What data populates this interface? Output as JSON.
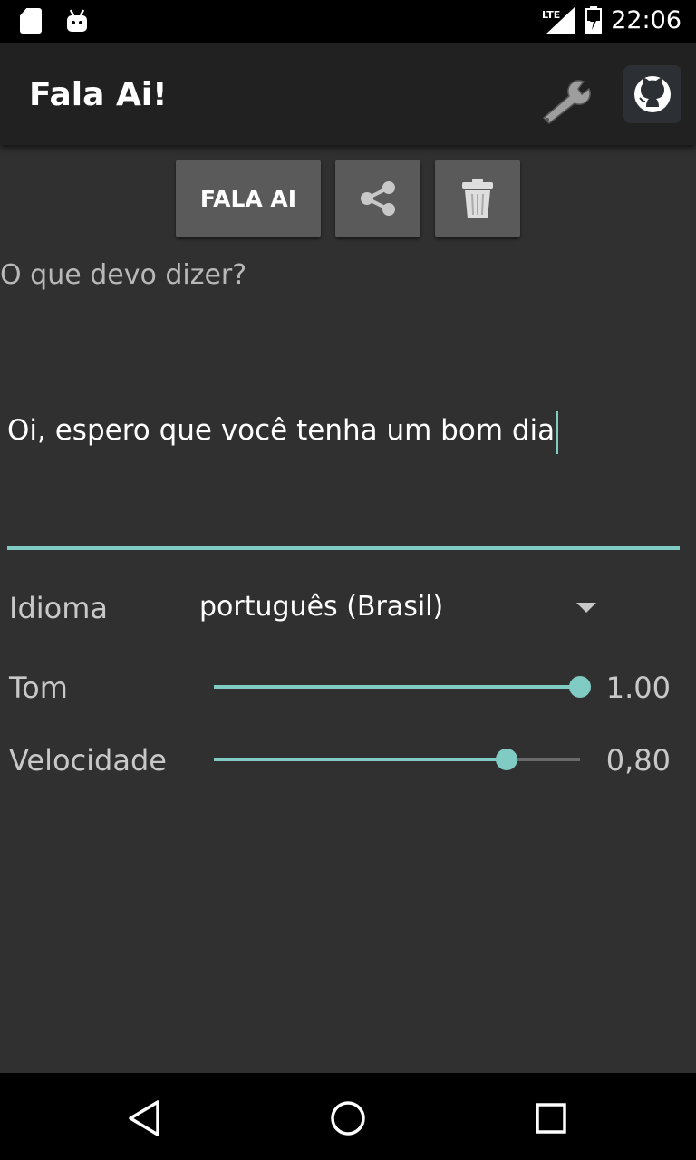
{
  "status_bar": {
    "time": "22:06",
    "network": "LTE",
    "icons": [
      "sd-card-icon",
      "android-icon",
      "lte-signal-icon",
      "battery-icon"
    ]
  },
  "app_bar": {
    "title": "Fala Ai!",
    "actions": [
      "wrench-icon",
      "github-icon"
    ]
  },
  "toolbar": {
    "speak_label": "FALA AI",
    "share_icon": "share-icon",
    "delete_icon": "trash-icon"
  },
  "prompt": {
    "label": "O que devo dizer?",
    "input_value": "Oi, espero que você tenha um bom dia"
  },
  "settings": {
    "language": {
      "label": "Idioma",
      "value": "português (Brasil)"
    },
    "pitch": {
      "label": "Tom",
      "value_text": "1.00",
      "fraction": 1.0
    },
    "speed": {
      "label": "Velocidade",
      "value_text": "0,80",
      "fraction": 0.8
    }
  },
  "colors": {
    "accent": "#80cbc4",
    "background": "#303030",
    "app_bar": "#212121",
    "button": "#5a5a5a"
  },
  "nav_bar": {
    "buttons": [
      "back-icon",
      "home-icon",
      "recents-icon"
    ]
  }
}
